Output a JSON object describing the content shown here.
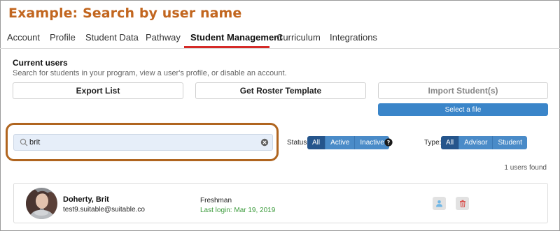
{
  "banner": {
    "title": "Example: Search by user name"
  },
  "tabs": [
    {
      "label": "Account"
    },
    {
      "label": "Profile"
    },
    {
      "label": "Student Data"
    },
    {
      "label": "Pathway"
    },
    {
      "label": "Student Management",
      "active": true
    },
    {
      "label": "Curriculum"
    },
    {
      "label": "Integrations"
    }
  ],
  "section": {
    "title": "Current users",
    "description": "Search for students in your program, view a user's profile, or disable an account."
  },
  "actions": {
    "export": "Export List",
    "roster": "Get Roster Template",
    "import": "Import Student(s)",
    "select_file": "Select a file"
  },
  "search": {
    "value": "brit",
    "placeholder": ""
  },
  "status_filter": {
    "label": "Status:",
    "options": [
      "All",
      "Active",
      "Inactive"
    ],
    "selected": "All"
  },
  "type_filter": {
    "label": "Type:",
    "options": [
      "All",
      "Advisor",
      "Student"
    ],
    "selected": "All"
  },
  "results": {
    "count_text": "1 users found"
  },
  "users": [
    {
      "name": "Doherty, Brit",
      "email": "test9.suitable@suitable.co",
      "grade": "Freshman",
      "last_login": "Last login: Mar 19, 2019"
    }
  ],
  "colors": {
    "banner": "#c2661f",
    "tab_underline": "#d52a27",
    "primary": "#3a85c9",
    "segment_active": "#25558c",
    "login_green": "#3a9a3a"
  },
  "icons": [
    "search-icon",
    "clear-icon",
    "help-icon",
    "user-icon",
    "trash-icon"
  ]
}
